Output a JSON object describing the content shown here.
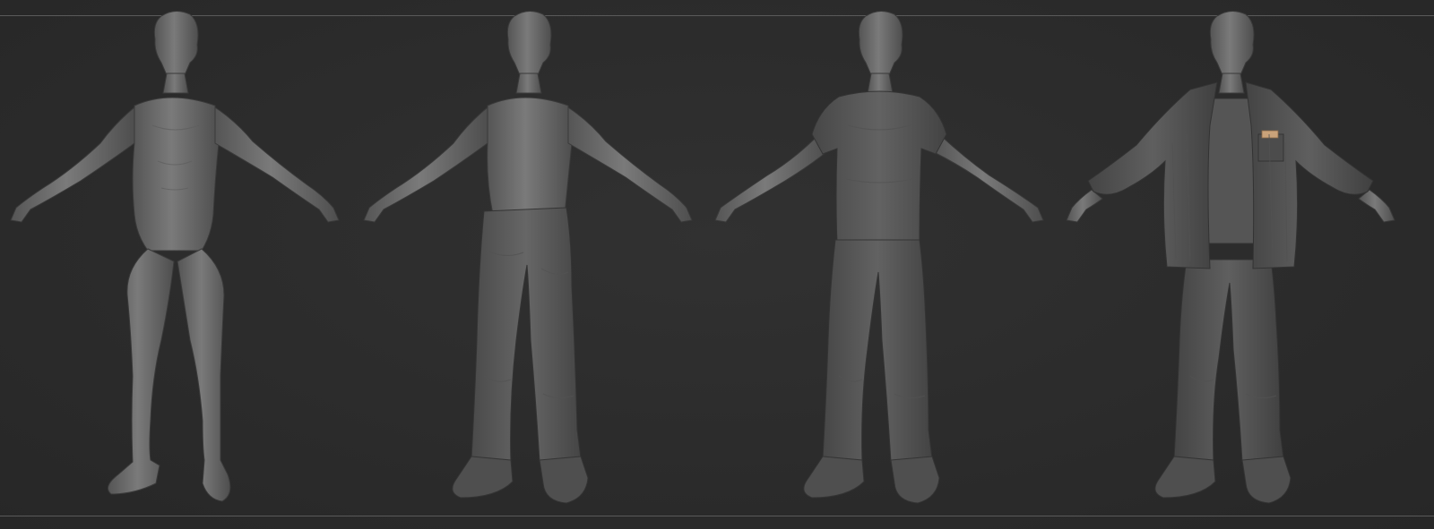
{
  "scene": {
    "background_color": "#2b2b2b",
    "guide_line_color": "#5a5a5a",
    "sculpt_color": "#6b6b6b"
  },
  "figures": [
    {
      "stage": "base-body",
      "clothing": []
    },
    {
      "stage": "pants-shoes",
      "clothing": [
        "jeans",
        "boots"
      ]
    },
    {
      "stage": "tshirt",
      "clothing": [
        "t-shirt",
        "jeans",
        "boots"
      ]
    },
    {
      "stage": "open-shirt",
      "clothing": [
        "open-button-shirt",
        "t-shirt",
        "jeans",
        "boots",
        "pocket-note"
      ]
    }
  ]
}
